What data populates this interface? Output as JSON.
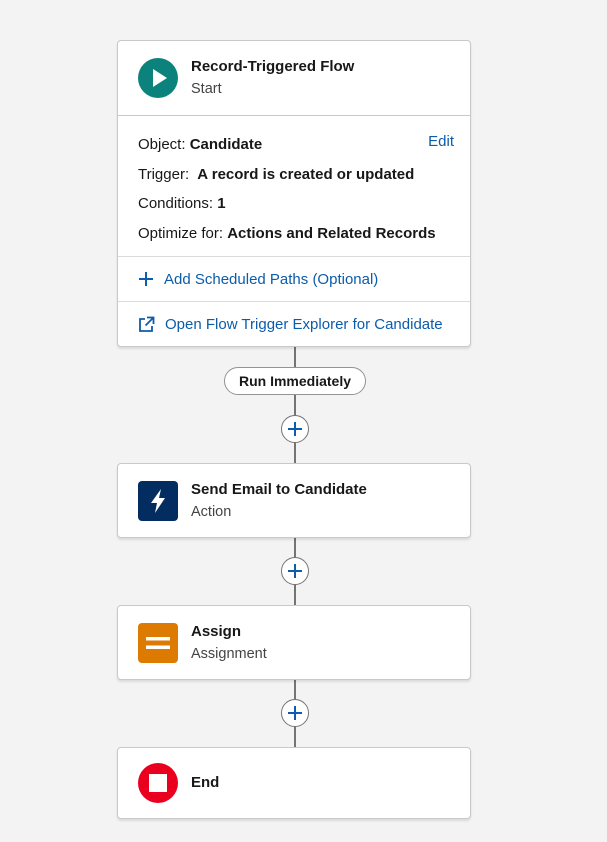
{
  "start": {
    "title": "Record-Triggered Flow",
    "subtitle": "Start",
    "object_label": "Object:",
    "object_value": "Candidate",
    "edit_label": "Edit",
    "trigger_label": "Trigger:",
    "trigger_value": "A record is created or updated",
    "conditions_label": "Conditions:",
    "conditions_value": "1",
    "optimize_label": "Optimize for:",
    "optimize_value": "Actions and Related Records",
    "scheduled_paths_link": "Add Scheduled Paths (Optional)",
    "explorer_link": "Open Flow Trigger Explorer for Candidate"
  },
  "path_label": "Run Immediately",
  "elements": {
    "action": {
      "title": "Send Email to Candidate",
      "subtitle": "Action"
    },
    "assignment": {
      "title": "Assign",
      "subtitle": "Assignment"
    },
    "end": {
      "title": "End"
    }
  },
  "colors": {
    "start_icon": "#0b827c",
    "action_icon": "#032d60",
    "assignment_icon": "#dd7a01",
    "end_icon": "#ea001e",
    "link": "#0b5cab"
  },
  "icons": {
    "start": "play-icon",
    "action": "lightning-bolt-icon",
    "assignment": "equals-icon",
    "end": "stop-icon",
    "add": "plus-icon",
    "external": "external-link-icon"
  }
}
